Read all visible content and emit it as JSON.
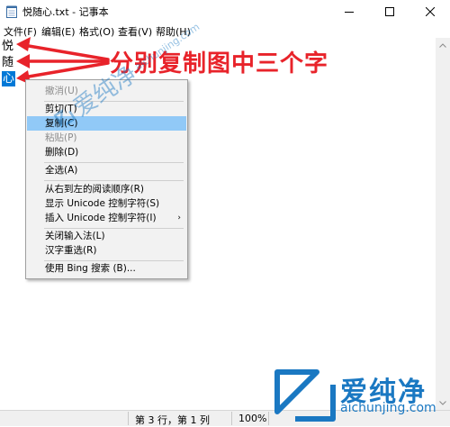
{
  "window": {
    "title": "悦随心.txt - 记事本"
  },
  "menubar": {
    "items": [
      {
        "label": "文件(F)"
      },
      {
        "label": "编辑(E)"
      },
      {
        "label": "格式(O)"
      },
      {
        "label": "查看(V)"
      },
      {
        "label": "帮助(H)"
      }
    ]
  },
  "editor": {
    "lines": [
      "悦",
      "随",
      "心"
    ],
    "selected_line": 3
  },
  "annotation": {
    "text": "分别复制图中三个字",
    "color": "#e8232a"
  },
  "context_menu": {
    "items": [
      {
        "label": "撤消(U)",
        "disabled": true
      },
      {
        "label": "剪切(T)"
      },
      {
        "label": "复制(C)",
        "highlighted": true
      },
      {
        "label": "粘贴(P)",
        "disabled": true
      },
      {
        "label": "删除(D)"
      },
      {
        "label": "全选(A)"
      },
      {
        "label": "从右到左的阅读顺序(R)"
      },
      {
        "label": "显示 Unicode 控制字符(S)"
      },
      {
        "label": "插入 Unicode 控制字符(I)",
        "submenu": true
      },
      {
        "label": "关闭输入法(L)"
      },
      {
        "label": "汉字重选(R)"
      },
      {
        "label": "使用 Bing 搜索 (B)..."
      }
    ]
  },
  "statusbar": {
    "position": "第 3 行，第 1 列",
    "zoom": "100%"
  },
  "watermark": {
    "brand": "爱纯净",
    "url": "aichunjing.com"
  },
  "colors": {
    "selection": "#0078d7",
    "menu_highlight": "#91c9f7",
    "watermark": "#1a78c2"
  }
}
